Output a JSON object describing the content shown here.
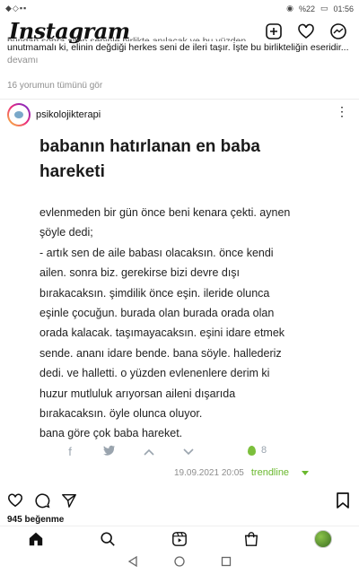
{
  "status_bar": {
    "time": "01:56",
    "battery": "%22",
    "left_icons": "◆◇▪▪"
  },
  "app": {
    "name": "Instagram"
  },
  "previous_post": {
    "caption_cut": "bundan sonra ailen seninle birlikte anılacak ve bu yüzden",
    "caption_line": "unutmamalı ki, elinin değdiği herkes seni de ileri taşır. İşte bu birlikteliğin eseridir...",
    "more_label": "devamı",
    "comments_link": "16 yorumun tümünü gör"
  },
  "post": {
    "username": "psikolojikterapi",
    "entry": {
      "title_lines": [
        "babanın hatırlanan en baba",
        "hareketi"
      ],
      "lines": [
        "evlenmeden bir gün önce beni kenara çekti. aynen",
        "şöyle dedi;",
        "- artık sen de aile babası olacaksın. önce kendi",
        "ailen. sonra biz. gerekirse bizi devre dışı",
        "bırakacaksın. şimdilik önce eşin. ileride olunca",
        "eşinle çocuğun. burada olan burada orada olan",
        "orada kalacak. taşımayacaksın. eşini idare etmek",
        "sende. ananı idare bende. bana söyle. hallederiz",
        "dedi. ve halletti. o yüzden evlenenlere derim ki",
        "huzur mutluluk arıyorsan aileni dışarıda",
        "bırakacaksın. öyle olunca oluyor.",
        "bana göre çok baba hareket."
      ],
      "share_icons": [
        "f",
        "t",
        "^",
        "v"
      ],
      "like_count": "8",
      "date": "19.09.2021 20:05",
      "brand": "trendline"
    },
    "likes": "945 beğenme"
  },
  "colors": {
    "brand_green": "#6ab82e",
    "muted": "#8e8e8e"
  }
}
